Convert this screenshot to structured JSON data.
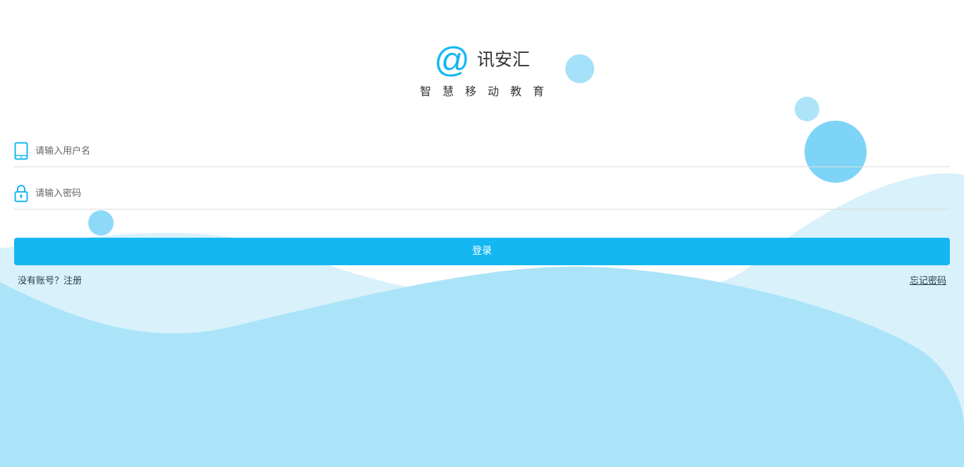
{
  "brand": {
    "logo_symbol": "@",
    "app_name": "讯安汇",
    "slogan": "智慧移动教育",
    "accent_color": "#14b7f2"
  },
  "form": {
    "username": {
      "icon": "tablet-icon",
      "placeholder": "请输入用户名",
      "value": ""
    },
    "password": {
      "icon": "lock-icon",
      "placeholder": "请输入密码",
      "value": ""
    },
    "login_label": "登录"
  },
  "links": {
    "register": "没有账号？注册",
    "forgot_password": "忘记密码"
  }
}
